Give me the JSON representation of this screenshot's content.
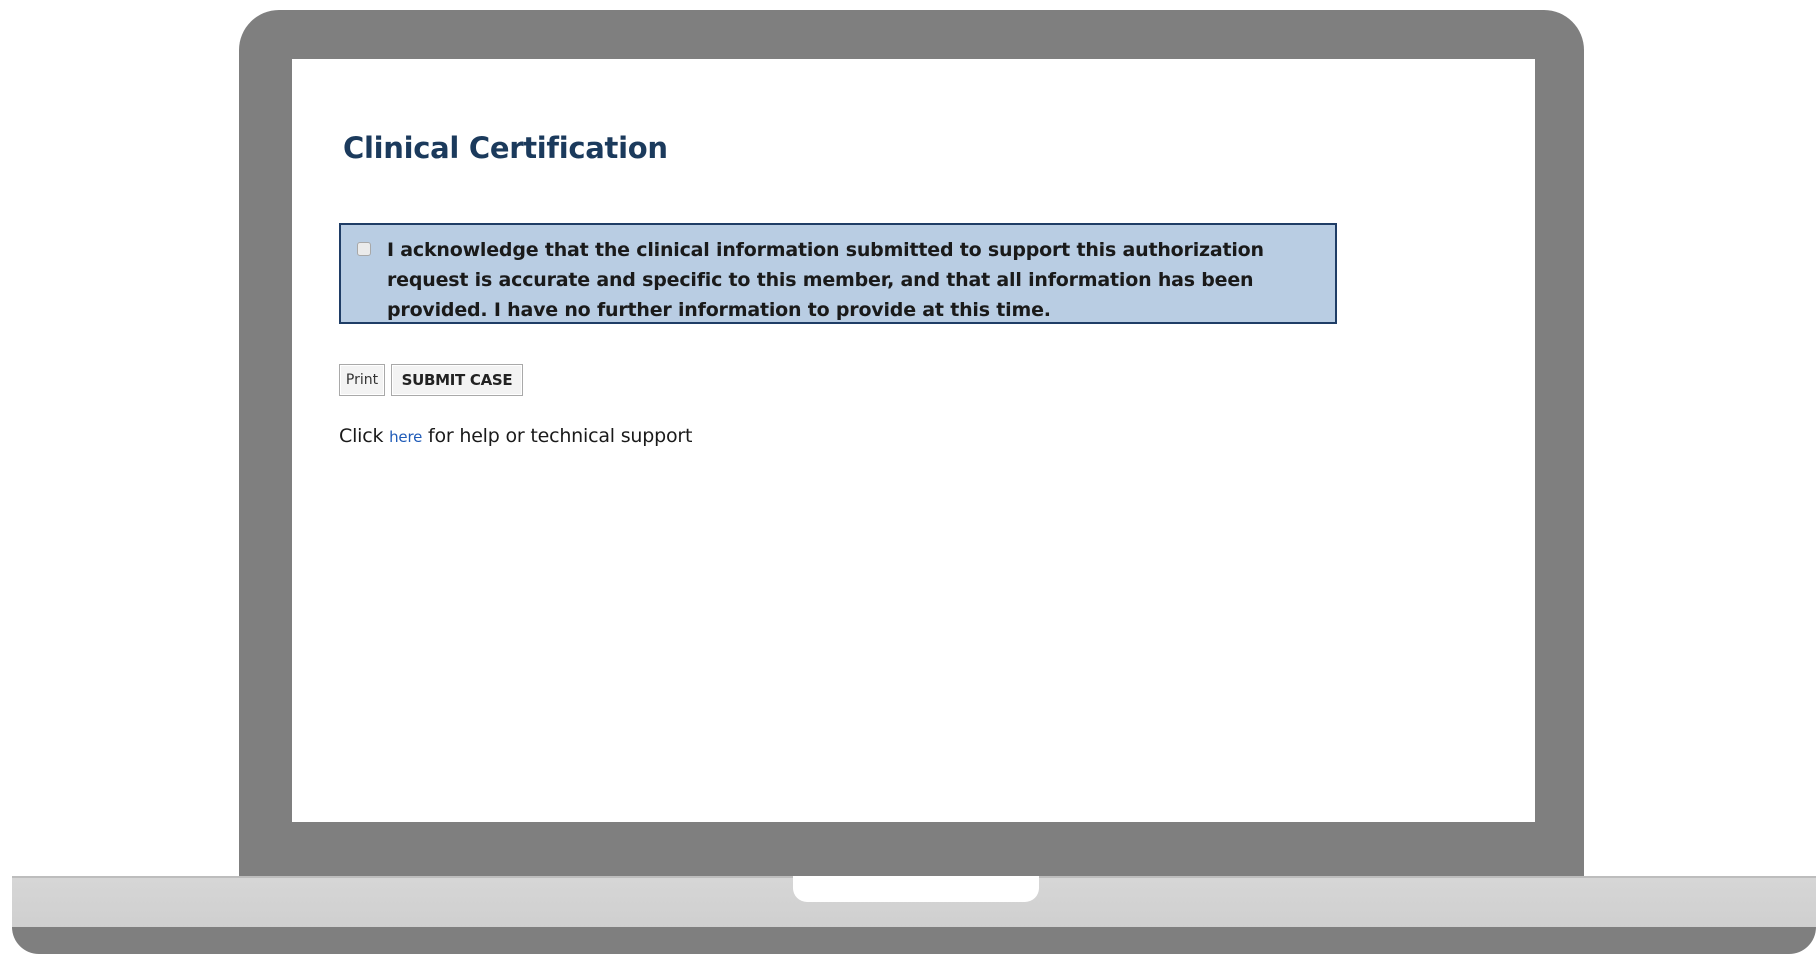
{
  "page": {
    "title": "Clinical Certification"
  },
  "acknowledgement": {
    "checked": false,
    "text": "I acknowledge that the clinical information submitted to support this authorization request is accurate and specific to this member, and that all information has been provided. I have no further information to provide at this time."
  },
  "actions": {
    "print_label": "Print",
    "submit_label": "SUBMIT CASE"
  },
  "help": {
    "prefix": "Click",
    "link_label": "here",
    "suffix": "for help or technical support"
  },
  "colors": {
    "title": "#1b3a5c",
    "ack_background": "#b9cde3",
    "ack_border": "#1f3d66",
    "link": "#1f5bb8",
    "laptop_frame": "#7f7f7f"
  }
}
